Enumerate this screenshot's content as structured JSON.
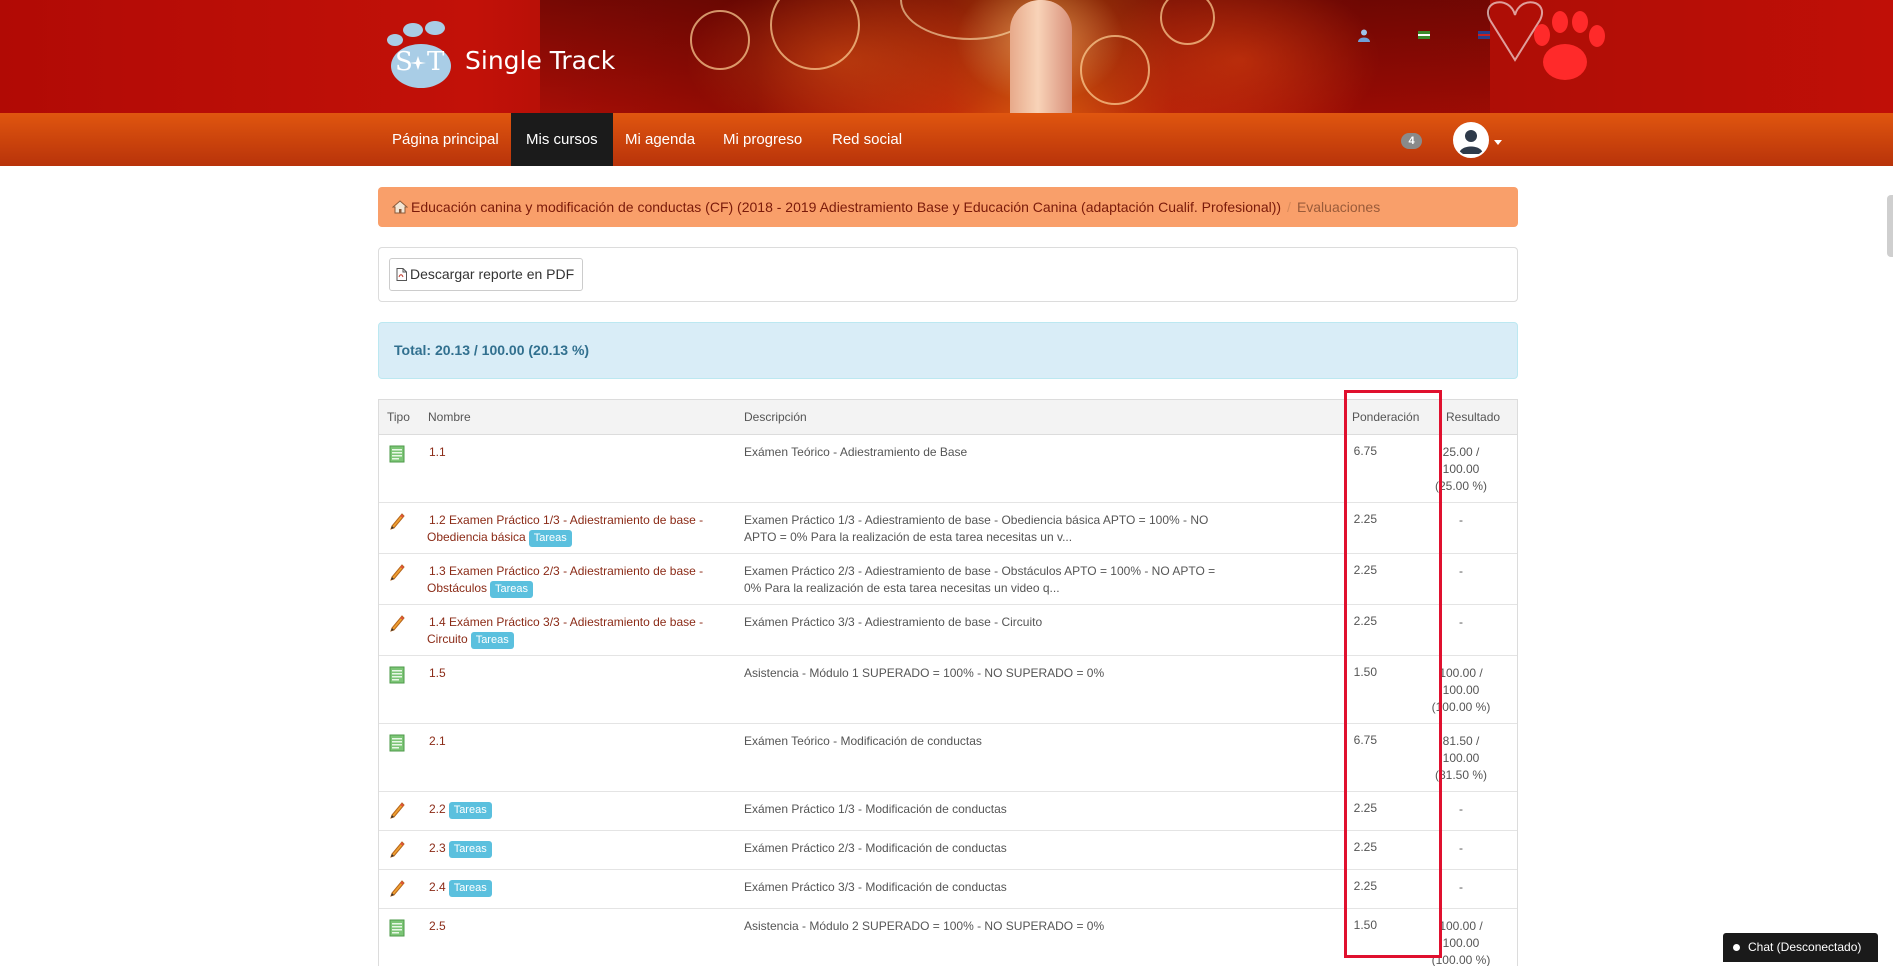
{
  "brand": {
    "name": "Single Track",
    "logo_letters": "S T"
  },
  "header": {
    "icons": [
      "user-icon",
      "flag-icon",
      "language-icon"
    ]
  },
  "nav": {
    "items": [
      {
        "label": "Página principal",
        "active": false
      },
      {
        "label": "Mis cursos",
        "active": true
      },
      {
        "label": "Mi agenda",
        "active": false
      },
      {
        "label": "Mi progreso",
        "active": false
      },
      {
        "label": "Red social",
        "active": false
      }
    ],
    "notification_count": "4"
  },
  "breadcrumb": {
    "course": "Educación canina y modificación de conductas (CF) (2018 - 2019 Adiestramiento Base y Educación Canina (adaptación Cualif. Profesional))",
    "separator": "/",
    "current": "Evaluaciones"
  },
  "toolbar": {
    "pdf_label": "Descargar reporte en PDF"
  },
  "total": {
    "label": "Total: 20.13 / 100.00 (20.13 %)"
  },
  "table": {
    "headers": {
      "tipo": "Tipo",
      "nombre": "Nombre",
      "descripcion": "Descripción",
      "ponderacion": "Ponderación",
      "resultado": "Resultado"
    },
    "tag_label": "Tareas",
    "rows": [
      {
        "type": "exam",
        "name": "1.1",
        "tag": false,
        "description": "Exámen Teórico - Adiestramiento de Base",
        "weight": "6.75",
        "result": [
          "25.00 /",
          "100.00",
          "(25.00 %)"
        ]
      },
      {
        "type": "task",
        "name": "1.2 Examen Práctico 1/3 - Adiestramiento de base - Obediencia básica",
        "tag": true,
        "description": "Examen Práctico 1/3 - Adiestramiento de base - Obediencia básica APTO = 100% - NO APTO = 0% Para la realización de esta tarea necesitas un v...",
        "weight": "2.25",
        "result": [
          "-"
        ]
      },
      {
        "type": "task",
        "name": "1.3 Examen Práctico 2/3 - Adiestramiento de base - Obstáculos",
        "tag": true,
        "description": "Examen Práctico 2/3 - Adiestramiento de base - Obstáculos APTO = 100% - NO APTO = 0% Para la realización de esta tarea necesitas un video q...",
        "weight": "2.25",
        "result": [
          "-"
        ]
      },
      {
        "type": "task",
        "name": "1.4 Exámen Práctico 3/3 - Adiestramiento de base - Circuito",
        "tag": true,
        "description": "Exámen Práctico 3/3 - Adiestramiento de base - Circuito",
        "weight": "2.25",
        "result": [
          "-"
        ]
      },
      {
        "type": "exam",
        "name": "1.5",
        "tag": false,
        "description": "Asistencia - Módulo 1 SUPERADO = 100% - NO SUPERADO = 0%",
        "weight": "1.50",
        "result": [
          "100.00 /",
          "100.00",
          "(100.00 %)"
        ]
      },
      {
        "type": "exam",
        "name": "2.1",
        "tag": false,
        "description": "Exámen Teórico - Modificación de conductas",
        "weight": "6.75",
        "result": [
          "81.50 /",
          "100.00",
          "(81.50 %)"
        ]
      },
      {
        "type": "task",
        "name": "2.2",
        "tag": true,
        "description": "Exámen Práctico 1/3 - Modificación de conductas",
        "weight": "2.25",
        "result": [
          "-"
        ]
      },
      {
        "type": "task",
        "name": "2.3",
        "tag": true,
        "description": "Exámen Práctico 2/3 - Modificación de conductas",
        "weight": "2.25",
        "result": [
          "-"
        ]
      },
      {
        "type": "task",
        "name": "2.4",
        "tag": true,
        "description": "Exámen Práctico 3/3 - Modificación de conductas",
        "weight": "2.25",
        "result": [
          "-"
        ]
      },
      {
        "type": "exam",
        "name": "2.5",
        "tag": false,
        "description": "Asistencia - Módulo 2 SUPERADO = 100% - NO SUPERADO = 0%",
        "weight": "1.50",
        "result": [
          "100.00 /",
          "100.00",
          "(100.00 %)"
        ]
      }
    ]
  },
  "chat": {
    "label": "Chat (Desconectado)"
  },
  "colors": {
    "brand_red": "#b10a05",
    "nav_orange": "#d24a0d",
    "breadcrumb_bg": "#f99f6a",
    "tag_blue": "#5bc0de",
    "highlight_red": "#e0102e",
    "link_brown": "#8b2b17"
  }
}
